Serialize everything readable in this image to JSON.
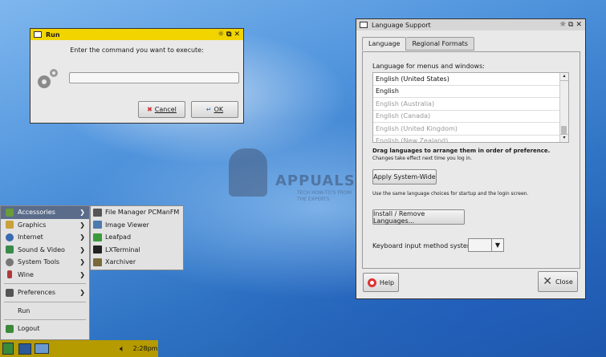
{
  "run_dialog": {
    "title": "Run",
    "prompt": "Enter the command you want to execute:",
    "input_value": "",
    "cancel_label": "Cancel",
    "ok_label": "OK"
  },
  "language_support": {
    "title": "Language Support",
    "tabs": [
      "Language",
      "Regional Formats"
    ],
    "list_heading": "Language for menus and windows:",
    "languages": [
      "English (United States)",
      "English",
      "English (Australia)",
      "English (Canada)",
      "English (United Kingdom)",
      "English (New Zealand)"
    ],
    "drag_hint": "Drag languages to arrange them in order of preference.",
    "drag_subhint": "Changes take effect next time you log in.",
    "apply_label": "Apply System-Wide",
    "apply_hint": "Use the same language choices for startup and the login screen.",
    "install_label": "Install / Remove Languages...",
    "keyboard_label": "Keyboard input method system:",
    "keyboard_value": "",
    "help_label": "Help",
    "close_label": "Close"
  },
  "start_menu": {
    "items": [
      {
        "label": "Accessories",
        "icon": "accessories-icon",
        "color": "#6a9a3a"
      },
      {
        "label": "Graphics",
        "icon": "graphics-icon",
        "color": "#c9a23a"
      },
      {
        "label": "Internet",
        "icon": "internet-icon",
        "color": "#3a6ab0"
      },
      {
        "label": "Sound & Video",
        "icon": "sound-video-icon",
        "color": "#3a8a4a"
      },
      {
        "label": "System Tools",
        "icon": "system-tools-icon",
        "color": "#777777"
      },
      {
        "label": "Wine",
        "icon": "wine-icon",
        "color": "#b03a3a"
      },
      {
        "label": "Preferences",
        "icon": "preferences-icon",
        "color": "#555555"
      },
      {
        "label": "Run",
        "icon": "",
        "color": ""
      },
      {
        "label": "Logout",
        "icon": "logout-icon",
        "color": "#3a8a3a"
      }
    ],
    "submenu": [
      {
        "label": "File Manager PCManFM",
        "icon": "file-manager-icon",
        "color": "#555555"
      },
      {
        "label": "Image Viewer",
        "icon": "image-viewer-icon",
        "color": "#4a7ab0"
      },
      {
        "label": "Leafpad",
        "icon": "leafpad-icon",
        "color": "#3a9a3a"
      },
      {
        "label": "LXTerminal",
        "icon": "terminal-icon",
        "color": "#222222"
      },
      {
        "label": "Xarchiver",
        "icon": "xarchiver-icon",
        "color": "#7a6a3a"
      }
    ]
  },
  "taskbar": {
    "clock": "2:28pm"
  },
  "watermark": {
    "brand": "APPUALS",
    "tagline": "TECH HOW-TO'S FROM THE EXPERTS"
  },
  "colors": {
    "taskbar": "#b59a00",
    "run_titlebar": "#f2d400",
    "menu_highlight": "#5a6c8a"
  }
}
